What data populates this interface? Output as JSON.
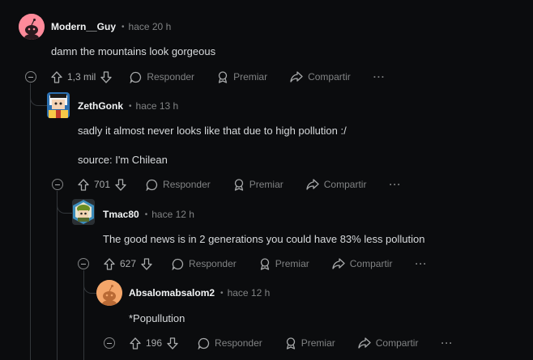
{
  "comments": [
    {
      "username": "Modern__Guy",
      "time": "hace 20 h",
      "lines": [
        "damn the mountains look gorgeous"
      ],
      "votes": "1,3 mil"
    },
    {
      "username": "ZethGonk",
      "time": "hace 13 h",
      "lines": [
        "sadly it almost never looks like that due to high pollution :/",
        "source: I'm Chilean"
      ],
      "votes": "701"
    },
    {
      "username": "Tmac80",
      "time": "hace 12 h",
      "lines": [
        "The good news is in 2 generations you could have 83% less pollution"
      ],
      "votes": "627"
    },
    {
      "username": "Absalomabsalom2",
      "time": "hace 12 h",
      "lines": [
        "*Popullution"
      ],
      "votes": "196"
    }
  ],
  "actions": {
    "reply": "Responder",
    "award": "Premiar",
    "share": "Compartir",
    "more": "···"
  },
  "colors": {
    "background": "#0b0c0e",
    "text": "#d7dadc",
    "muted": "#818384",
    "thread_line": "#33373b"
  }
}
